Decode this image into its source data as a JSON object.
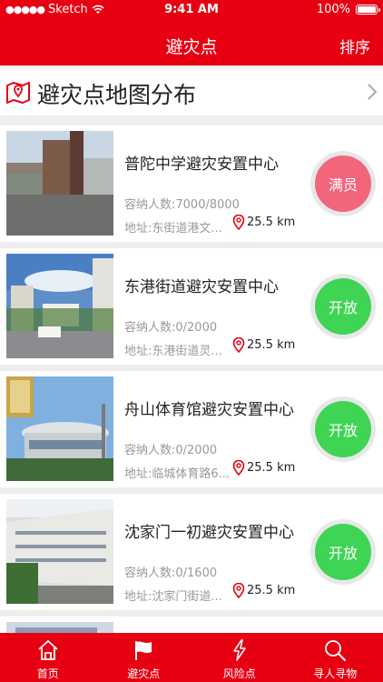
{
  "status_bar": {
    "carrier": "Sketch",
    "time": "9:41 AM",
    "battery": "100%"
  },
  "nav": {
    "title": "避灾点",
    "sort_label": "排序"
  },
  "map_entry": {
    "label": "避灾点地图分布",
    "icon": "map-pin-icon"
  },
  "shelters": [
    {
      "name": "普陀中学避灾安置中心",
      "capacity": "容纳人数:7000/8000",
      "address": "地址:东街道港文...",
      "distance": "25.5 km",
      "status": "满员",
      "status_type": "full",
      "status_color": "#f2657a"
    },
    {
      "name": "东港街道避灾安置中心",
      "capacity": "容纳人数:0/2000",
      "address": "地址:东港街道灵...",
      "distance": "25.5 km",
      "status": "开放",
      "status_type": "open",
      "status_color": "#3fd454"
    },
    {
      "name": "舟山体育馆避灾安置中心",
      "capacity": "容纳人数:0/2000",
      "address": "地址:临城体育路6...",
      "distance": "25.5 km",
      "status": "开放",
      "status_type": "open",
      "status_color": "#3fd454"
    },
    {
      "name": "沈家门一初避灾安置中心",
      "capacity": "容纳人数:0/1600",
      "address": "地址:沈家门街道...",
      "distance": "25.5 km",
      "status": "开放",
      "status_type": "open",
      "status_color": "#3fd454"
    }
  ],
  "tabbar": [
    {
      "label": "首页",
      "icon": "home-icon"
    },
    {
      "label": "避灾点",
      "icon": "flag-icon"
    },
    {
      "label": "风险点",
      "icon": "lightning-icon"
    },
    {
      "label": "寻人寻物",
      "icon": "search-icon"
    }
  ],
  "colors": {
    "brand": "#e60012",
    "full": "#f2657a",
    "open": "#3fd454"
  }
}
